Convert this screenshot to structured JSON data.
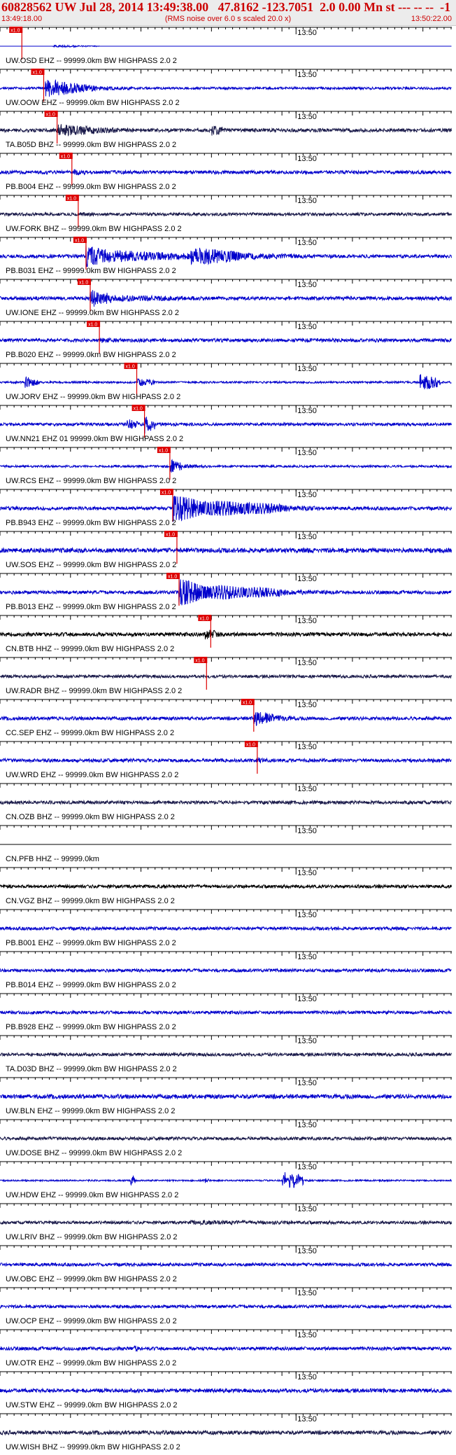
{
  "header": {
    "title": "60828562 UW Jul 28, 2014 13:49:38.00   47.8162 -123.7051  2.0 0.00 Mn st --- -- --  -1",
    "subtitle": "(RMS noise over 6.0 s scaled 20.0 x)",
    "start_time": "13:49:18.00",
    "end_time": "13:50:22.00"
  },
  "colors": {
    "trace_blue": "#0000cc",
    "trace_dark": "#1a1a4a",
    "trace_black": "#000000",
    "pick_red": "#dd0000",
    "header_bg": "#ececec",
    "title_red": "#cc0000"
  },
  "chart_data": {
    "type": "line",
    "title": "60828562 UW Jul 28, 2014 13:49:38.00   47.8162 -123.7051  2.0 0.00 Mn st --- -- --  -1",
    "subtitle": "(RMS noise over 6.0 s scaled 20.0 x)",
    "time_range": [
      "13:49:18.00",
      "13:50:22.00"
    ],
    "time_range_seconds": [
      0,
      64
    ],
    "minute_mark": {
      "label": "13:50",
      "t": 42
    },
    "grid": false,
    "traces": [
      {
        "label": "UW.OSD EHZ -- 99999.0km BW  HIGHPASS  2.0  2",
        "color": "blue",
        "pick": {
          "label": "x1.0",
          "t": 3.1
        },
        "amp": 2,
        "noise": 0.06,
        "bursts": [
          {
            "t0": 7.5,
            "t1": 11.5,
            "a": 1.0
          },
          {
            "t0": 11.5,
            "t1": 14,
            "a": 0.5
          }
        ],
        "flat": true
      },
      {
        "label": "UW.OOW EHZ -- 99999.0km BW  HIGHPASS  2.0  2",
        "color": "blue",
        "pick": {
          "label": "x1.0",
          "t": 6.2
        },
        "amp": 14,
        "noise": 0.12,
        "bursts": [
          {
            "t0": 6.4,
            "t1": 10.5,
            "a": 1.0
          },
          {
            "t0": 10.5,
            "t1": 13.5,
            "a": 0.55
          },
          {
            "t0": 13.5,
            "t1": 19,
            "a": 0.25
          }
        ]
      },
      {
        "label": "TA.B05D BHZ -- 99999.0km BW  HIGHPASS  2.0  2",
        "color": "dark",
        "pick": {
          "label": "x1.0",
          "t": 8.1
        },
        "amp": 10,
        "noise": 0.25,
        "bursts": [
          {
            "t0": 8.2,
            "t1": 14,
            "a": 0.9
          },
          {
            "t0": 14,
            "t1": 20,
            "a": 0.45
          },
          {
            "t0": 30,
            "t1": 32,
            "a": 0.8
          }
        ]
      },
      {
        "label": "PB.B004 EHZ -- 99999.0km BW  HIGHPASS  2.0  2",
        "color": "blue",
        "pick": {
          "label": "x1.0",
          "t": 10.2
        },
        "amp": 8,
        "noise": 0.3,
        "bursts": [
          {
            "t0": 10.5,
            "t1": 12.5,
            "a": 0.6
          },
          {
            "t0": 20,
            "t1": 50,
            "a": 0.25
          }
        ]
      },
      {
        "label": "UW.FORK BHZ -- 99999.0km BW  HIGHPASS  2.0  2",
        "color": "dark",
        "pick": {
          "label": "x1.0",
          "t": 11.1
        },
        "amp": 6,
        "noise": 0.35,
        "bursts": [
          {
            "t0": 11.2,
            "t1": 16,
            "a": 0.5
          }
        ]
      },
      {
        "label": "PB.B031 EHZ -- 99999.0km BW  HIGHPASS  2.0  2",
        "color": "blue",
        "pick": {
          "label": "x1.0",
          "t": 12.2
        },
        "amp": 16,
        "noise": 0.15,
        "bursts": [
          {
            "t0": 12.2,
            "t1": 16,
            "a": 1.0
          },
          {
            "t0": 16,
            "t1": 27,
            "a": 0.55
          },
          {
            "t0": 27,
            "t1": 34,
            "a": 0.85
          },
          {
            "t0": 34,
            "t1": 45,
            "a": 0.3
          }
        ]
      },
      {
        "label": "UW.IONE EHZ -- 99999.0km BW  HIGHPASS  2.0  2",
        "color": "blue",
        "pick": {
          "label": "x1.0",
          "t": 12.8
        },
        "amp": 14,
        "noise": 0.18,
        "bursts": [
          {
            "t0": 12.8,
            "t1": 16,
            "a": 0.95
          },
          {
            "t0": 16,
            "t1": 30,
            "a": 0.35
          }
        ]
      },
      {
        "label": "PB.B020 EHZ -- 99999.0km BW  HIGHPASS  2.0  2",
        "color": "blue",
        "pick": {
          "label": "x1.0",
          "t": 14.1
        },
        "amp": 8,
        "noise": 0.3,
        "bursts": [
          {
            "t0": 14.2,
            "t1": 17,
            "a": 0.5
          }
        ]
      },
      {
        "label": "UW.JORV EHZ -- 99999.0km BW  HIGHPASS  2.0  2",
        "color": "blue",
        "pick": {
          "label": "x1.0",
          "t": 19.4
        },
        "amp": 12,
        "noise": 0.12,
        "bursts": [
          {
            "t0": 3.5,
            "t1": 5.5,
            "a": 0.8
          },
          {
            "t0": 19.5,
            "t1": 22,
            "a": 0.5
          },
          {
            "t0": 59.5,
            "t1": 62.5,
            "a": 1.0
          }
        ]
      },
      {
        "label": "UW.NN21 EHZ 01 99999.0km BW  HIGHPASS  2.0  2",
        "color": "blue",
        "pick": {
          "label": "x1.0",
          "t": 20.5
        },
        "amp": 14,
        "noise": 0.15,
        "bursts": [
          {
            "t0": 18,
            "t1": 19.5,
            "a": 0.6
          },
          {
            "t0": 20.5,
            "t1": 22,
            "a": 1.0
          }
        ]
      },
      {
        "label": "UW.RCS EHZ -- 99999.0km BW  HIGHPASS  2.0  2",
        "color": "blue",
        "pick": {
          "label": "x1.0",
          "t": 24.1
        },
        "amp": 10,
        "noise": 0.15,
        "bursts": [
          {
            "t0": 24.2,
            "t1": 25.8,
            "a": 1.0
          },
          {
            "t0": 25.8,
            "t1": 30,
            "a": 0.3
          }
        ]
      },
      {
        "label": "PB.B943 EHZ -- 99999.0km BW  HIGHPASS  2.0  2",
        "color": "blue",
        "pick": {
          "label": "x1.0",
          "t": 24.5
        },
        "amp": 20,
        "noise": 0.12,
        "bursts": [
          {
            "t0": 24.5,
            "t1": 29,
            "a": 1.0
          },
          {
            "t0": 29,
            "t1": 40,
            "a": 0.6
          },
          {
            "t0": 40,
            "t1": 50,
            "a": 0.2
          }
        ],
        "tonal": true
      },
      {
        "label": "UW.SOS EHZ -- 99999.0km BW  HIGHPASS  2.0  2",
        "color": "blue",
        "pick": {
          "label": "x1.0",
          "t": 25.1
        },
        "amp": 6,
        "noise": 0.55,
        "bursts": [
          {
            "t0": 25.2,
            "t1": 28,
            "a": 0.6
          }
        ]
      },
      {
        "label": "PB.B013 EHZ -- 99999.0km BW  HIGHPASS  2.0  2",
        "color": "blue",
        "pick": {
          "label": "x1.0",
          "t": 25.4
        },
        "amp": 20,
        "noise": 0.12,
        "bursts": [
          {
            "t0": 25.4,
            "t1": 29,
            "a": 1.0
          },
          {
            "t0": 29,
            "t1": 40,
            "a": 0.55
          },
          {
            "t0": 40,
            "t1": 50,
            "a": 0.2
          }
        ],
        "tonal": true
      },
      {
        "label": "CN.BTB HHZ -- 99999.0km BW  HIGHPASS  2.0  2",
        "color": "black",
        "pick": {
          "label": "x1.0",
          "t": 29.9
        },
        "amp": 9,
        "noise": 0.3,
        "bursts": [
          {
            "t0": 29,
            "t1": 31.5,
            "a": 0.9
          }
        ]
      },
      {
        "label": "UW.RADR BHZ -- 99999.0km BW  HIGHPASS  2.0  2",
        "color": "dark",
        "pick": {
          "label": "x1.0",
          "t": 29.3
        },
        "amp": 6,
        "noise": 0.35,
        "bursts": [
          {
            "t0": 29.5,
            "t1": 31,
            "a": 0.4
          }
        ]
      },
      {
        "label": "CC.SEP EHZ -- 99999.0km BW  HIGHPASS  2.0  2",
        "color": "blue",
        "pick": {
          "label": "x1.0",
          "t": 36.0
        },
        "amp": 12,
        "noise": 0.2,
        "bursts": [
          {
            "t0": 36,
            "t1": 39,
            "a": 1.0
          },
          {
            "t0": 39,
            "t1": 42,
            "a": 0.4
          }
        ]
      },
      {
        "label": "UW.WRD EHZ -- 99999.0km BW  HIGHPASS  2.0  2",
        "color": "blue",
        "pick": {
          "label": "x1.0",
          "t": 36.5
        },
        "amp": 8,
        "noise": 0.3,
        "bursts": [
          {
            "t0": 36.5,
            "t1": 38,
            "a": 0.6
          }
        ]
      },
      {
        "label": "CN.OZB BHZ -- 99999.0km BW  HIGHPASS  2.0  2",
        "color": "dark",
        "pick": null,
        "amp": 6,
        "noise": 0.4,
        "bursts": []
      },
      {
        "label": "CN.PFB HHZ -- 99999.0km",
        "color": "black",
        "pick": null,
        "amp": 1,
        "noise": 0.0,
        "bursts": [],
        "flat": true
      },
      {
        "label": "CN.VGZ BHZ -- 99999.0km BW  HIGHPASS  2.0  2",
        "color": "black",
        "pick": null,
        "amp": 5,
        "noise": 0.45,
        "bursts": []
      },
      {
        "label": "PB.B001 EHZ -- 99999.0km BW  HIGHPASS  2.0  2",
        "color": "blue",
        "pick": null,
        "amp": 5,
        "noise": 0.45,
        "bursts": []
      },
      {
        "label": "PB.B014 EHZ -- 99999.0km BW  HIGHPASS  2.0  2",
        "color": "blue",
        "pick": null,
        "amp": 5,
        "noise": 0.45,
        "bursts": []
      },
      {
        "label": "PB.B928 EHZ -- 99999.0km BW  HIGHPASS  2.0  2",
        "color": "blue",
        "pick": null,
        "amp": 5,
        "noise": 0.45,
        "bursts": []
      },
      {
        "label": "TA.D03D BHZ -- 99999.0km BW  HIGHPASS  2.0  2",
        "color": "dark",
        "pick": null,
        "amp": 5,
        "noise": 0.45,
        "bursts": []
      },
      {
        "label": "UW.BLN EHZ -- 99999.0km BW  HIGHPASS  2.0  2",
        "color": "blue",
        "pick": null,
        "amp": 6,
        "noise": 0.5,
        "bursts": []
      },
      {
        "label": "UW.DOSE BHZ -- 99999.0km BW  HIGHPASS  2.0  2",
        "color": "dark",
        "pick": null,
        "amp": 5,
        "noise": 0.45,
        "bursts": []
      },
      {
        "label": "UW.HDW EHZ -- 99999.0km BW  HIGHPASS  2.0  2",
        "color": "blue",
        "pick": null,
        "amp": 14,
        "noise": 0.08,
        "bursts": [
          {
            "t0": 18.5,
            "t1": 19.2,
            "a": 0.6
          },
          {
            "t0": 29,
            "t1": 29.6,
            "a": 0.4
          },
          {
            "t0": 40,
            "t1": 43,
            "a": 1.0
          }
        ]
      },
      {
        "label": "UW.LRIV BHZ -- 99999.0km BW  HIGHPASS  2.0  2",
        "color": "dark",
        "pick": null,
        "amp": 7,
        "noise": 0.3,
        "bursts": [
          {
            "t0": 27,
            "t1": 60,
            "a": 0.45
          }
        ]
      },
      {
        "label": "UW.OBC EHZ -- 99999.0km BW  HIGHPASS  2.0  2",
        "color": "blue",
        "pick": null,
        "amp": 5,
        "noise": 0.45,
        "bursts": []
      },
      {
        "label": "UW.OCP EHZ -- 99999.0km BW  HIGHPASS  2.0  2",
        "color": "blue",
        "pick": null,
        "amp": 5,
        "noise": 0.45,
        "bursts": []
      },
      {
        "label": "UW.OTR EHZ -- 99999.0km BW  HIGHPASS  2.0  2",
        "color": "blue",
        "pick": null,
        "amp": 6,
        "noise": 0.4,
        "bursts": [
          {
            "t0": 19,
            "t1": 20,
            "a": 0.8
          }
        ]
      },
      {
        "label": "UW.STW EHZ -- 99999.0km BW  HIGHPASS  2.0  2",
        "color": "blue",
        "pick": null,
        "amp": 6,
        "noise": 0.45,
        "bursts": []
      },
      {
        "label": "UW.WISH BHZ -- 99999.0km BW  HIGHPASS  2.0  2",
        "color": "dark",
        "pick": null,
        "amp": 6,
        "noise": 0.45,
        "bursts": []
      }
    ]
  }
}
